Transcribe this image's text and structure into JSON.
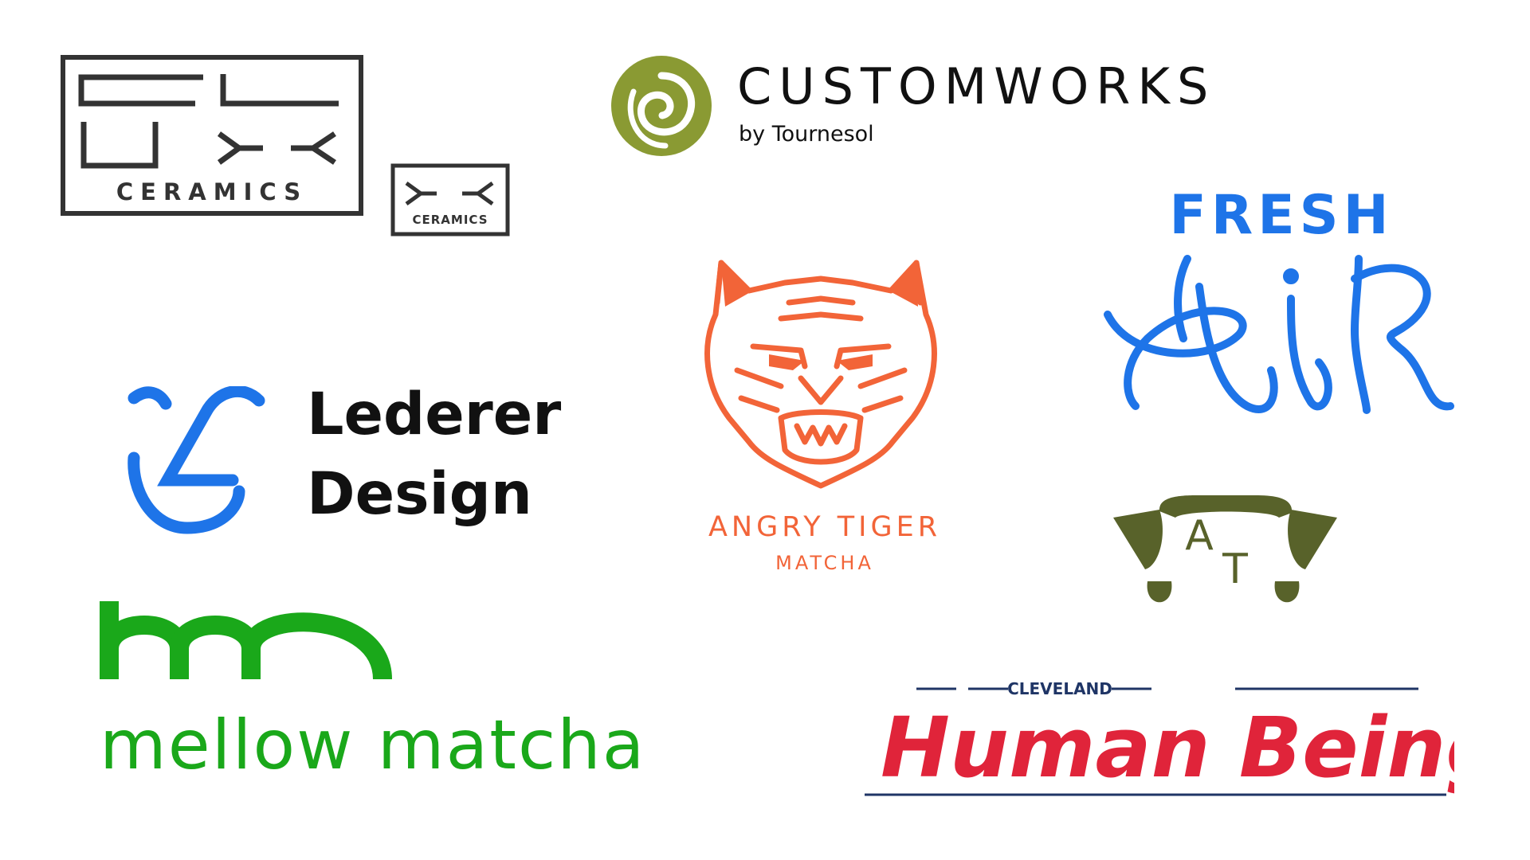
{
  "page": {
    "background": "#ffffff"
  },
  "logos": {
    "flux_ceramics": {
      "wordmark": "CERAMICS",
      "small_wordmark": "CERAMICS",
      "color": "#333333"
    },
    "customworks": {
      "name": "CUSTOMWORKS",
      "byline": "by Tournesol",
      "icon": "green-spiral-icon",
      "icon_color": "#8a9a33",
      "text_color": "#111111"
    },
    "fresh_air": {
      "line1": "FRESH",
      "line2": "AiR",
      "color": "#1e74e8"
    },
    "lederer": {
      "line1": "Lederer",
      "line2": "Design",
      "mark_color": "#1e74e8",
      "text_color": "#111111"
    },
    "angry_tiger": {
      "line1": "ANGRY TIGER",
      "line2": "MATCHA",
      "color": "#f26438",
      "icon": "tiger-face-icon"
    },
    "at_mark": {
      "letters": "AT",
      "color": "#58622a",
      "icon": "dog-face-icon"
    },
    "mellow": {
      "monogram": "mm",
      "name": "mellow matcha",
      "color": "#1aa81a"
    },
    "human_beings": {
      "kicker": "CLEVELAND",
      "name": "Human Beings",
      "text_color": "#e0243a",
      "line_color": "#1f3566"
    }
  }
}
